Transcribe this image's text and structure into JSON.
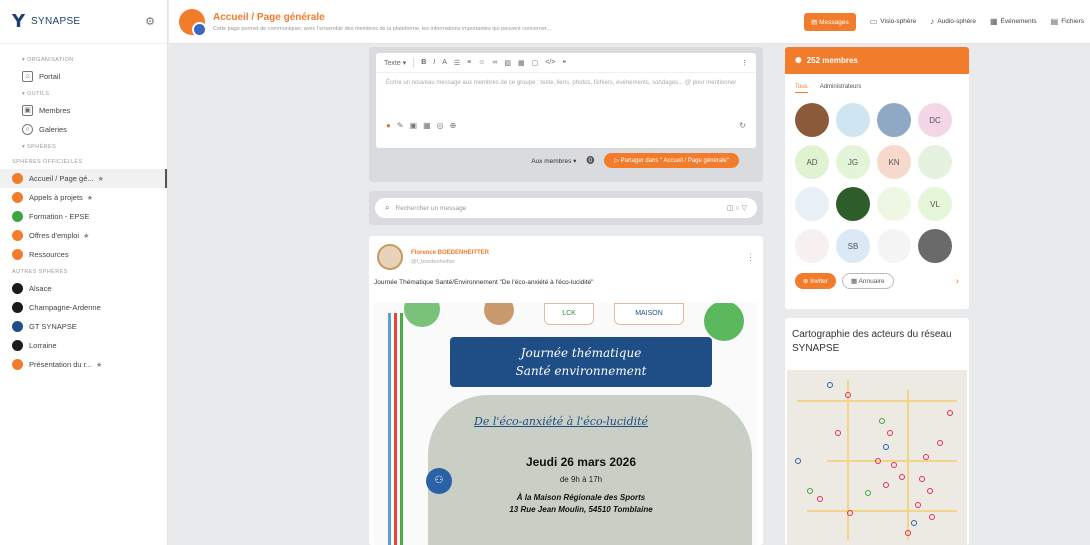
{
  "brand": {
    "name": "SYNAPSE"
  },
  "sidebar": {
    "sections": {
      "organisation": "ORGANISATION",
      "outils": "OUTILS",
      "spheres": "SPHÈRES",
      "officielles": "SPHÈRES OFFICIELLES",
      "autres": "AUTRES SPHÈRES"
    },
    "portail": "Portail",
    "membres": "Membres",
    "galeries": "Galeries",
    "official": [
      {
        "label": "Accueil / Page gé...",
        "color": "#f07c2c",
        "star": "★"
      },
      {
        "label": "Appels à projets",
        "color": "#f07c2c",
        "star": "★"
      },
      {
        "label": "Formation - EPSE",
        "color": "#3fa541",
        "star": ""
      },
      {
        "label": "Offres d'emploi",
        "color": "#f07c2c",
        "star": "★"
      },
      {
        "label": "Ressources",
        "color": "#f07c2c",
        "star": ""
      }
    ],
    "others": [
      {
        "label": "Alsace",
        "color": "#1a1a1a",
        "star": ""
      },
      {
        "label": "Champagne-Ardenne",
        "color": "#1a1a1a",
        "star": ""
      },
      {
        "label": "GT SYNAPSE",
        "color": "#1f4d86",
        "star": ""
      },
      {
        "label": "Lorraine",
        "color": "#1a1a1a",
        "star": ""
      },
      {
        "label": "Présentation du r...",
        "color": "#f07c2c",
        "star": "★"
      }
    ]
  },
  "header": {
    "title": "Accueil / Page générale",
    "description": "Cette page permet de communiquer, avec l'ensemble des membres de la plateforme, les informations importantes qui peuvent concerner...",
    "primary": "Messages",
    "links": [
      {
        "icon": "video-icon",
        "glyph": "▭",
        "label": "Visio-sphère"
      },
      {
        "icon": "mic-icon",
        "glyph": "♪",
        "label": "Audio-sphère"
      },
      {
        "icon": "calendar-icon",
        "glyph": "▦",
        "label": "Événements"
      },
      {
        "icon": "folder-icon",
        "glyph": "▤",
        "label": "Fichiers"
      }
    ]
  },
  "composer": {
    "toolbar_format": "Texte",
    "placeholder": "Écrire un nouveau message aux membres de ce groupe : texte, liens, photos, fichiers, événements, sondages... @ pour mentionner",
    "audience": "Aux membres ▾",
    "share": "Partager dans \" Accueil / Page générale\""
  },
  "search": {
    "placeholder": "Rechercher un message"
  },
  "post": {
    "author": "Florence BOEDENHEITTER",
    "handle": "@f_boedenheitter",
    "text": "Journée Thématique Santé/Environnement \"De l'éco-anxiété à l'éco-lucidité\"",
    "poster": {
      "banner_line1": "Journée thématique",
      "banner_line2": "Santé environnement",
      "subtitle": "De l'éco-anxiété à l'éco-lucidité",
      "date": "Jeudi 26 mars 2026",
      "time": "de 9h à 17h",
      "place_line1": "À la Maison Régionale des Sports",
      "place_line2": "13 Rue Jean Moulin, 54510 Tomblaine",
      "logo_left": "LCK",
      "logo_right": "MAISON"
    }
  },
  "members": {
    "title": "252 membres",
    "tabs": [
      "Tous",
      "Administrateurs"
    ],
    "avatars": [
      {
        "label": "",
        "bg": "#8a5a3a"
      },
      {
        "label": "",
        "bg": "#cfe6f2"
      },
      {
        "label": "",
        "bg": "#8fa8c4"
      },
      {
        "label": "DC",
        "bg": "#f5d6e8"
      },
      {
        "label": "AD",
        "bg": "#e0f3d0"
      },
      {
        "label": "JG",
        "bg": "#e4f4d8"
      },
      {
        "label": "KN",
        "bg": "#f6d9cc"
      },
      {
        "label": "",
        "bg": "#e6f2e0"
      },
      {
        "label": "",
        "bg": "#e8f0f8"
      },
      {
        "label": "",
        "bg": "#2f5d2a"
      },
      {
        "label": "",
        "bg": "#eef6e4"
      },
      {
        "label": "VL",
        "bg": "#e6f6d8"
      },
      {
        "label": "",
        "bg": "#f6f0f0"
      },
      {
        "label": "SB",
        "bg": "#dbe9f6"
      },
      {
        "label": "",
        "bg": "#f4f4f4"
      },
      {
        "label": "",
        "bg": "#6a6a6a"
      }
    ],
    "invite": "Inviter",
    "directory": "Annuaire"
  },
  "map": {
    "title": "Cartographie des acteurs du réseau SYNAPSE"
  },
  "colors": {
    "accent": "#f07c2c",
    "brand": "#1e3f6e"
  }
}
